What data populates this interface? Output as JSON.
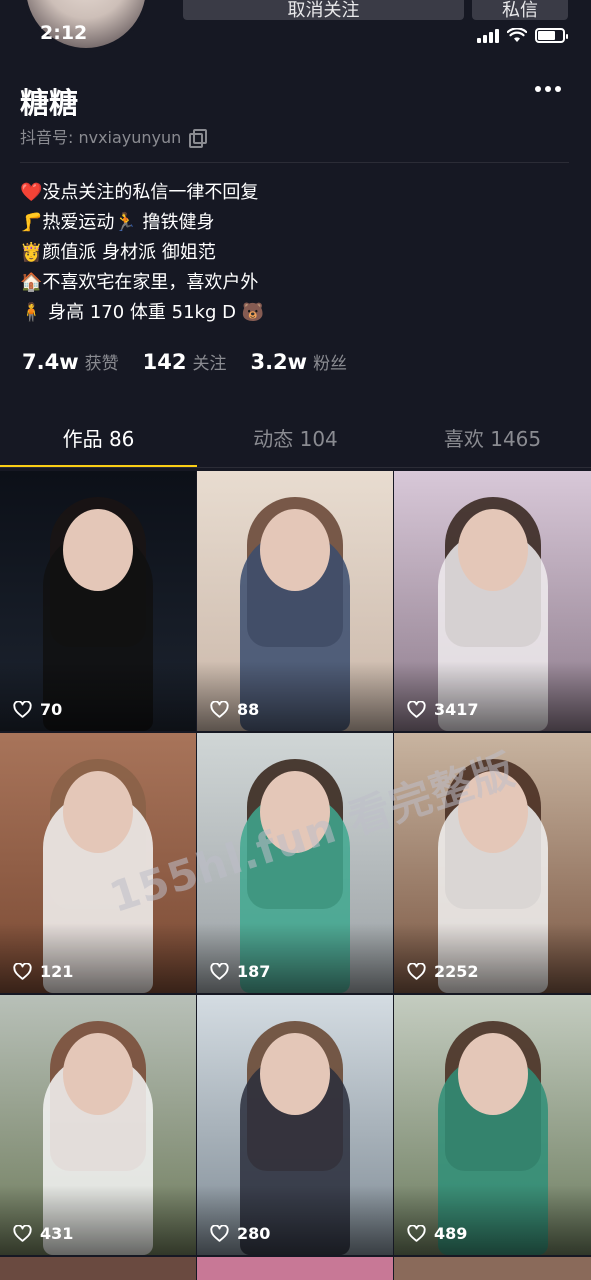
{
  "status_bar": {
    "time": "2:12"
  },
  "top_buttons": {
    "unfollow": "取消关注",
    "message": "私信"
  },
  "profile": {
    "nickname": "糖糖",
    "douyin_id": "抖音号: nvxiayunyun",
    "bio": [
      "❤️没点关注的私信一律不回复",
      "🦵热爱运动🏃 撸铁健身",
      "👸颜值派 身材派 御姐范",
      "🏠不喜欢宅在家里，喜欢户外",
      "🧍 身高 170 体重 51kg D 🐻"
    ]
  },
  "stats": [
    {
      "value": "7.4w",
      "label": "获赞"
    },
    {
      "value": "142",
      "label": "关注"
    },
    {
      "value": "3.2w",
      "label": "粉丝"
    }
  ],
  "tabs": [
    {
      "label": "作品 86",
      "active": true
    },
    {
      "label": "动态 104",
      "active": false
    },
    {
      "label": "喜欢 1465",
      "active": false
    }
  ],
  "videos": [
    {
      "likes": "70",
      "bg": "#1d2430",
      "top": "#0c1018",
      "outfit": "#111111",
      "hair": "#1a1414"
    },
    {
      "likes": "88",
      "bg": "#c9b6a8",
      "top": "#e8dcd0",
      "outfit": "#3a4c6e",
      "hair": "#6b4a3a"
    },
    {
      "likes": "3417",
      "bg": "#8c7a8a",
      "top": "#d8c8d8",
      "outfit": "#f0ecee",
      "hair": "#3b2a24"
    },
    {
      "likes": "121",
      "bg": "#7a4a34",
      "top": "#a8745a",
      "outfit": "#f4f4f4",
      "hair": "#8a6248"
    },
    {
      "likes": "187",
      "bg": "#9aa0a4",
      "top": "#d0d6d6",
      "outfit": "#3fa88f",
      "hair": "#3b2a20"
    },
    {
      "likes": "2252",
      "bg": "#7a5642",
      "top": "#c8b4a0",
      "outfit": "#f2f2f2",
      "hair": "#4a3024"
    },
    {
      "likes": "431",
      "bg": "#6d7a5a",
      "top": "#b8c0b8",
      "outfit": "#f6f6f6",
      "hair": "#7a4e3a"
    },
    {
      "likes": "280",
      "bg": "#7e8a94",
      "top": "#d4dce2",
      "outfit": "#2a2e3c",
      "hair": "#6a4a36"
    },
    {
      "likes": "489",
      "bg": "#6a7a5c",
      "top": "#c4ccc0",
      "outfit": "#2f8f78",
      "hair": "#4a3226"
    }
  ],
  "watermark": "155hl.fun 看完整版"
}
